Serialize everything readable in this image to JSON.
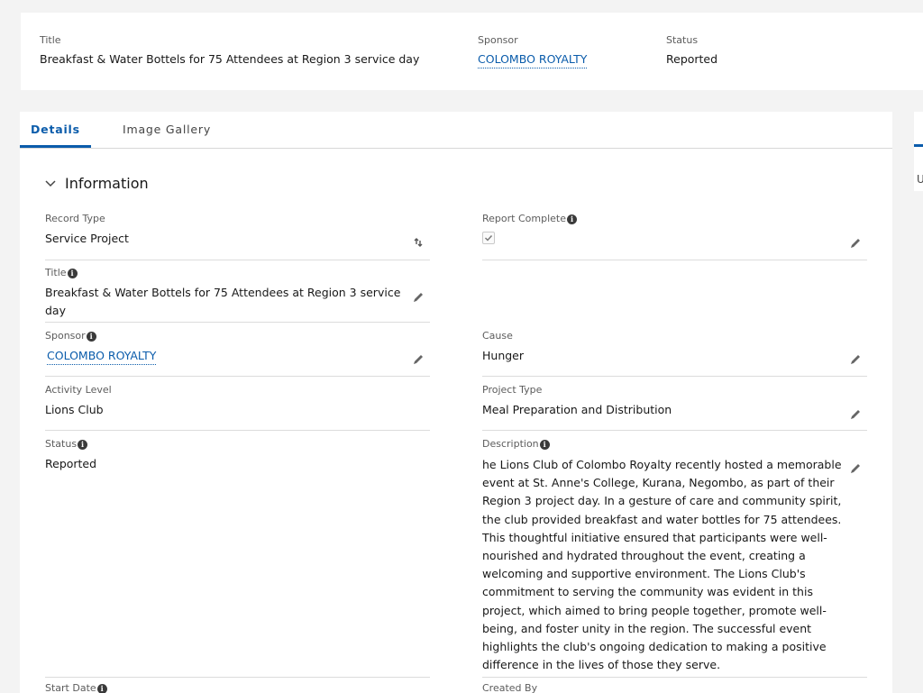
{
  "highlights": {
    "title_label": "Title",
    "title_value": "Breakfast & Water Bottels for 75 Attendees at Region 3 service day",
    "sponsor_label": "Sponsor",
    "sponsor_value": "COLOMBO ROYALTY",
    "status_label": "Status",
    "status_value": "Reported"
  },
  "tabs": [
    {
      "label": "Details",
      "active": true
    },
    {
      "label": "Image Gallery",
      "active": false
    }
  ],
  "section": {
    "title": "Information"
  },
  "fields": {
    "record_type": {
      "label": "Record Type",
      "value": "Service Project"
    },
    "report_complete": {
      "label": "Report Complete",
      "checked": true
    },
    "title": {
      "label": "Title",
      "value": "Breakfast & Water Bottels for 75 Attendees at Region 3 service day"
    },
    "sponsor": {
      "label": "Sponsor",
      "value": "COLOMBO ROYALTY"
    },
    "cause": {
      "label": "Cause",
      "value": "Hunger"
    },
    "activity_level": {
      "label": "Activity Level",
      "value": "Lions Club"
    },
    "project_type": {
      "label": "Project Type",
      "value": "Meal Preparation and Distribution"
    },
    "status": {
      "label": "Status",
      "value": "Reported"
    },
    "description": {
      "label": "Description",
      "lines": [
        "he Lions Club of Colombo Royalty recently hosted a memorable",
        "event at St. Anne's College, Kurana, Negombo, as part of their",
        "Region 3 project day. In a gesture of care and community spirit,",
        "the club provided breakfast and water bottles for 75 attendees.",
        "This thoughtful initiative ensured that participants were well-",
        "nourished and hydrated throughout the event, creating a",
        "welcoming and supportive environment. The Lions Club's",
        "commitment to serving the community was evident in this",
        "project, which aimed to bring people together, promote well-",
        "being, and foster unity in the region. The successful event",
        "highlights the club's ongoing dedication to making a positive",
        "difference in the lives of those they serve."
      ]
    },
    "start_date": {
      "label": "Start Date"
    },
    "created_by": {
      "label": "Created By"
    }
  },
  "side_panel": {
    "letter": "U"
  },
  "colors": {
    "accent": "#0b5cab",
    "background": "#f3f3f3"
  }
}
